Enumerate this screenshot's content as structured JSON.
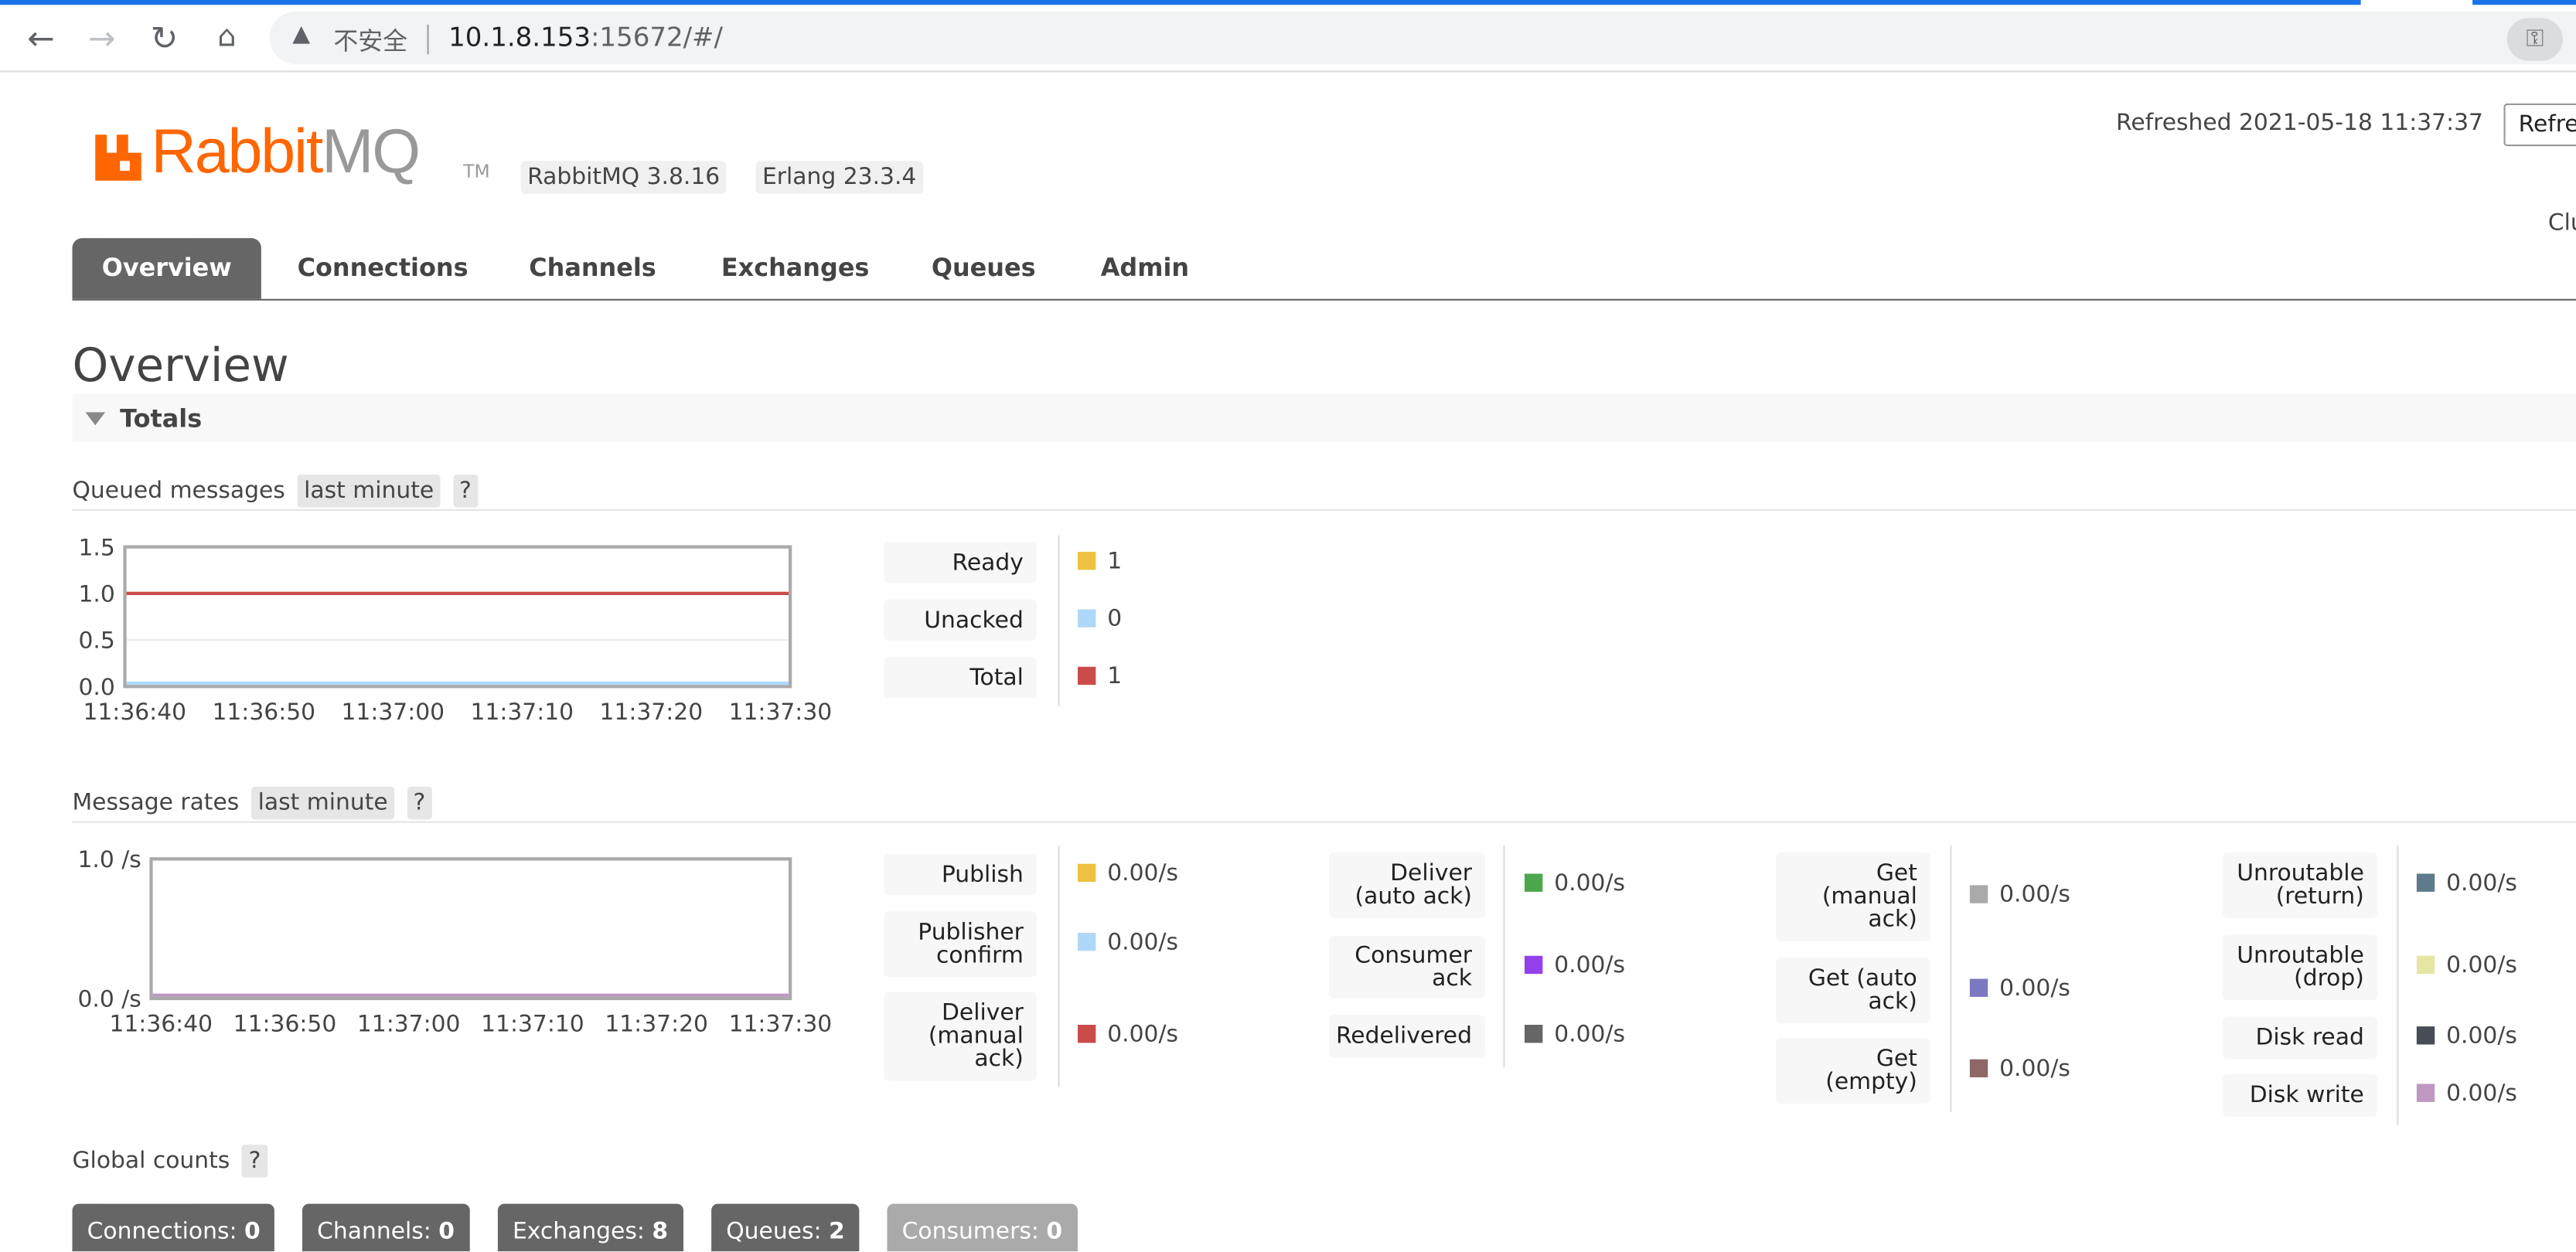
{
  "browser": {
    "insecure_label": "不安全",
    "url_host": "10.1.8.153",
    "url_rest": ":15672/#/"
  },
  "header": {
    "logo_rabbit": "Rabbit",
    "logo_mq": "MQ",
    "logo_tm": "TM",
    "rabbitmq_version": "RabbitMQ 3.8.16",
    "erlang_version": "Erlang 23.3.4",
    "refreshed": "Refreshed 2021-05-18 11:37:37",
    "refresh_select_value": "Refre",
    "cluster_truncated": "Clu"
  },
  "tabs": [
    {
      "label": "Overview",
      "active": true
    },
    {
      "label": "Connections",
      "active": false
    },
    {
      "label": "Channels",
      "active": false
    },
    {
      "label": "Exchanges",
      "active": false
    },
    {
      "label": "Queues",
      "active": false
    },
    {
      "label": "Admin",
      "active": false
    }
  ],
  "page_title": "Overview",
  "totals_label": "Totals",
  "queued": {
    "label": "Queued messages",
    "range": "last minute",
    "help": "?",
    "legend": [
      {
        "label": "Ready",
        "value": "1",
        "color": "#edc240"
      },
      {
        "label": "Unacked",
        "value": "0",
        "color": "#afd8f8"
      },
      {
        "label": "Total",
        "value": "1",
        "color": "#cb4b4b"
      }
    ]
  },
  "rates": {
    "label": "Message rates",
    "range": "last minute",
    "help": "?",
    "col1": [
      {
        "label": "Publish",
        "value": "0.00/s",
        "color": "#edc240"
      },
      {
        "label": "Publisher confirm",
        "value": "0.00/s",
        "color": "#afd8f8"
      },
      {
        "label": "Deliver (manual ack)",
        "value": "0.00/s",
        "color": "#cb4b4b"
      }
    ],
    "col2": [
      {
        "label": "Deliver (auto ack)",
        "value": "0.00/s",
        "color": "#4da74d"
      },
      {
        "label": "Consumer ack",
        "value": "0.00/s",
        "color": "#9440ed"
      },
      {
        "label": "Redelivered",
        "value": "0.00/s",
        "color": "#666666"
      }
    ],
    "col3": [
      {
        "label": "Get (manual ack)",
        "value": "0.00/s",
        "color": "#aaaaaa"
      },
      {
        "label": "Get (auto ack)",
        "value": "0.00/s",
        "color": "#7c79c3"
      },
      {
        "label": "Get (empty)",
        "value": "0.00/s",
        "color": "#8e6767"
      }
    ],
    "col4": [
      {
        "label": "Unroutable (return)",
        "value": "0.00/s",
        "color": "#5e7b8b"
      },
      {
        "label": "Unroutable (drop)",
        "value": "0.00/s",
        "color": "#e6e6a4"
      },
      {
        "label": "Disk read",
        "value": "0.00/s",
        "color": "#474d56"
      },
      {
        "label": "Disk write",
        "value": "0.00/s",
        "color": "#bf99c2"
      }
    ]
  },
  "global_counts": {
    "label": "Global counts",
    "help": "?",
    "items": [
      {
        "label": "Connections:",
        "value": "0"
      },
      {
        "label": "Channels:",
        "value": "0"
      },
      {
        "label": "Exchanges:",
        "value": "8"
      },
      {
        "label": "Queues:",
        "value": "2"
      },
      {
        "label": "Consumers:",
        "value": "0"
      }
    ]
  },
  "chart_data": [
    {
      "type": "line",
      "x": [
        "11:36:40",
        "11:36:50",
        "11:37:00",
        "11:37:10",
        "11:37:20",
        "11:37:30"
      ],
      "yticks": [
        "1.5",
        "1.0",
        "0.5",
        "0.0"
      ],
      "ylim": [
        0,
        1.5
      ],
      "series": [
        {
          "name": "Ready",
          "color": "#edc240",
          "values": [
            1,
            1,
            1,
            1,
            1,
            1
          ]
        },
        {
          "name": "Unacked",
          "color": "#afd8f8",
          "values": [
            0,
            0,
            0,
            0,
            0,
            0
          ]
        },
        {
          "name": "Total",
          "color": "#cb4b4b",
          "values": [
            1,
            1,
            1,
            1,
            1,
            1
          ]
        }
      ]
    },
    {
      "type": "line",
      "x": [
        "11:36:40",
        "11:36:50",
        "11:37:00",
        "11:37:10",
        "11:37:20",
        "11:37:30"
      ],
      "yticks": [
        "1.0 /s",
        "0.0 /s"
      ],
      "ylim": [
        0,
        1.0
      ],
      "series": [
        {
          "name": "Disk write",
          "color": "#bf99c2",
          "values": [
            0,
            0,
            0,
            0,
            0,
            0
          ]
        }
      ]
    }
  ]
}
